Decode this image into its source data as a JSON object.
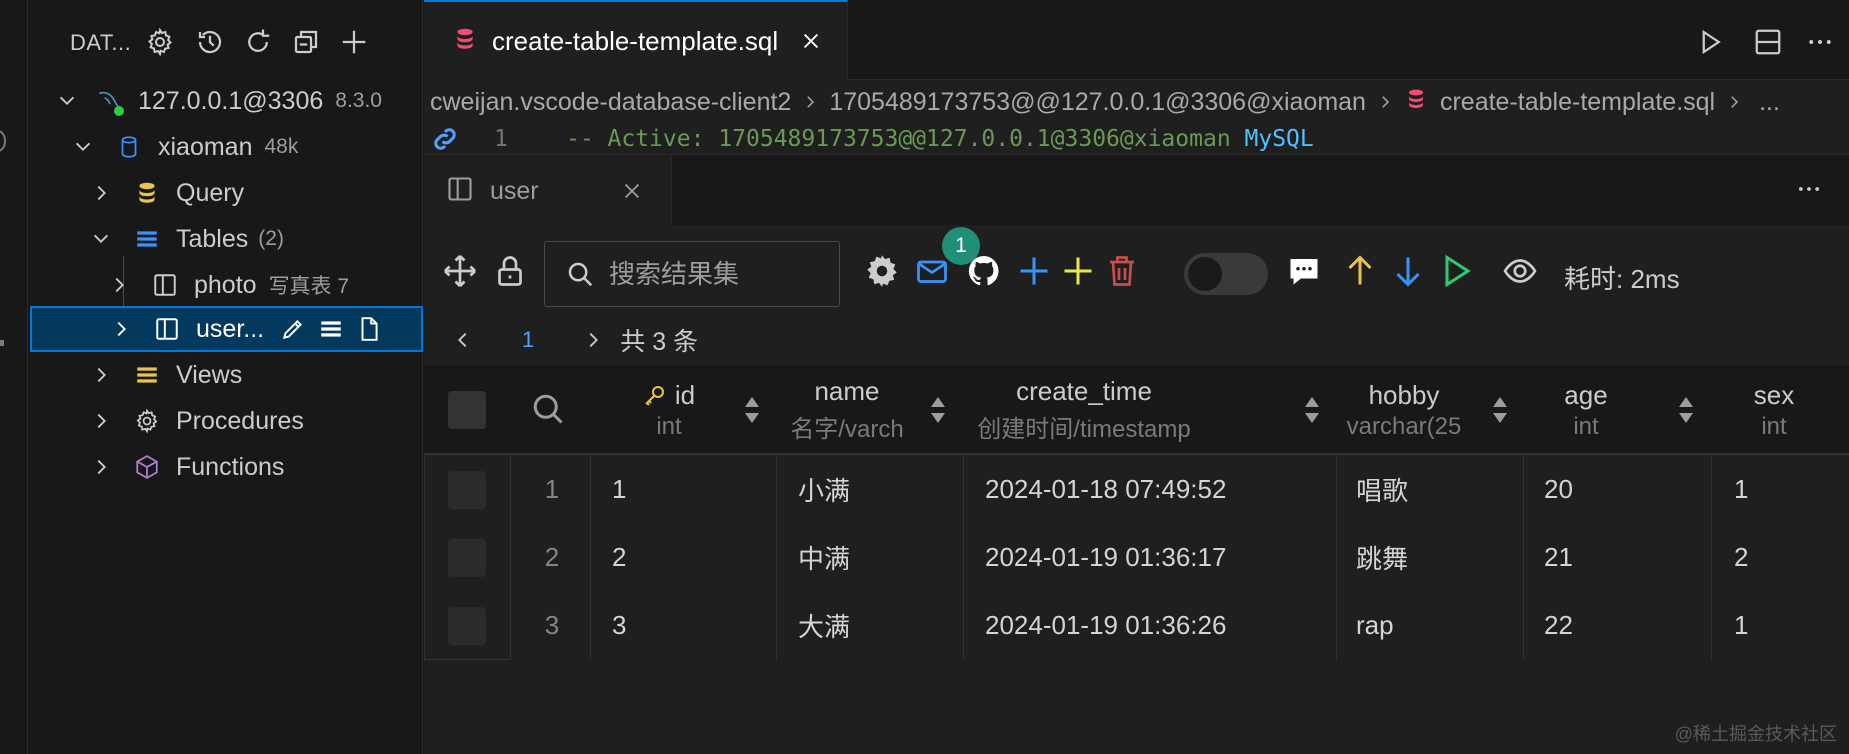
{
  "sidebar": {
    "title": "DAT...",
    "header_icons": [
      "gear-icon",
      "history-icon",
      "refresh-icon",
      "collapse-all-icon",
      "add-icon"
    ],
    "connection": {
      "label": "127.0.0.1@3306",
      "version": "8.3.0"
    },
    "database": {
      "label": "xiaoman",
      "size": "48k"
    },
    "items": {
      "query": "Query",
      "tables": {
        "label": "Tables",
        "count": "(2)"
      },
      "photo": {
        "label": "photo",
        "comment": "写真表 7"
      },
      "user": {
        "label": "user..."
      },
      "views": "Views",
      "procedures": "Procedures",
      "functions": "Functions"
    }
  },
  "editor": {
    "tab_label": "create-table-template.sql",
    "breadcrumb": [
      "cweijan.vscode-database-client2",
      "1705489173753@@127.0.0.1@3306@xiaoman",
      "create-table-template.sql"
    ],
    "code_line": {
      "number": "1",
      "text": "-- Active: 1705489173753@@127.0.0.1@3306@xiaoman ",
      "keyword": "MySQL"
    }
  },
  "result_panel": {
    "tab_label": "user",
    "search": {
      "placeholder": "搜索结果集",
      "value": ""
    },
    "badge_count": "1",
    "elapsed": "耗时: 2ms",
    "pager": {
      "page": "1",
      "total": "共 3 条"
    },
    "columns": [
      {
        "name": "id",
        "type": "int",
        "primary_key": true
      },
      {
        "name": "name",
        "type": "名字/varch"
      },
      {
        "name": "create_time",
        "type": "创建时间/timestamp"
      },
      {
        "name": "hobby",
        "type": "varchar(25"
      },
      {
        "name": "age",
        "type": "int"
      },
      {
        "name": "sex",
        "type": "int"
      }
    ],
    "rows": [
      {
        "rn": "1",
        "cells": [
          "1",
          "小满",
          "2024-01-18 07:49:52",
          "唱歌",
          "20",
          "1"
        ]
      },
      {
        "rn": "2",
        "cells": [
          "2",
          "中满",
          "2024-01-19 01:36:17",
          "跳舞",
          "21",
          "2"
        ]
      },
      {
        "rn": "3",
        "cells": [
          "3",
          "大满",
          "2024-01-19 01:36:26",
          "rap",
          "22",
          "1"
        ]
      }
    ]
  },
  "watermark": "@稀土掘金技术社区",
  "colors": {
    "accent": "#0078d4",
    "selected_bg": "#04395e",
    "database_icon": "#f14c6e",
    "folder_yellow": "#e8c44b",
    "table_blue": "#3794ff",
    "badge": "#1f8f7a"
  }
}
